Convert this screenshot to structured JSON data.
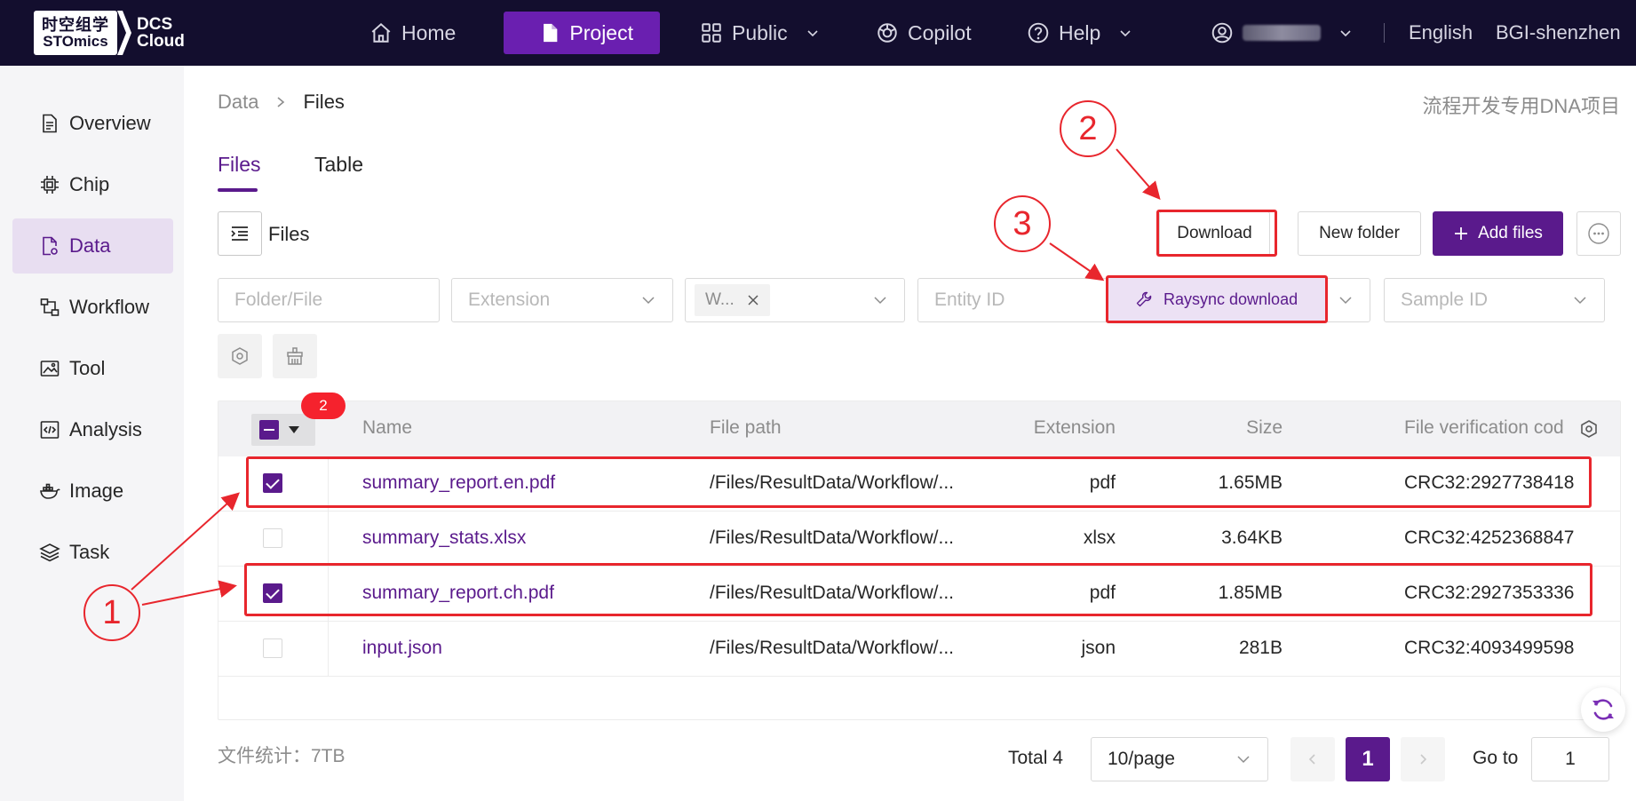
{
  "header": {
    "logo_line1": "时空组学",
    "logo_line2": "STOmics",
    "logo_right1": "DCS",
    "logo_right2": "Cloud",
    "nav": [
      {
        "label": "Home"
      },
      {
        "label": "Project"
      },
      {
        "label": "Public"
      },
      {
        "label": "Copilot"
      },
      {
        "label": "Help"
      }
    ],
    "language": "English",
    "org": "BGI-shenzhen"
  },
  "sidebar": {
    "items": [
      {
        "label": "Overview",
        "icon": "document-icon"
      },
      {
        "label": "Chip",
        "icon": "chip-icon"
      },
      {
        "label": "Data",
        "icon": "data-file-icon"
      },
      {
        "label": "Workflow",
        "icon": "workflow-icon"
      },
      {
        "label": "Tool",
        "icon": "tool-icon"
      },
      {
        "label": "Analysis",
        "icon": "code-icon"
      },
      {
        "label": "Image",
        "icon": "docker-icon"
      },
      {
        "label": "Task",
        "icon": "layers-icon"
      }
    ]
  },
  "breadcrumb": {
    "parent": "Data",
    "current": "Files"
  },
  "project_name": "流程开发专用DNA项目",
  "tabs": [
    {
      "label": "Files"
    },
    {
      "label": "Table"
    }
  ],
  "toolbar": {
    "files_label": "Files",
    "download": "Download",
    "new_folder": "New folder",
    "add_files": "Add files",
    "raysync": "Raysync download"
  },
  "filters": {
    "folder_placeholder": "Folder/File",
    "extension_placeholder": "Extension",
    "tag_value": "W...",
    "entity_placeholder": "Entity ID",
    "sample_placeholder": "Sample ID"
  },
  "table": {
    "selected_count": "2",
    "columns": [
      "Name",
      "File path",
      "Extension",
      "Size",
      "File verification cod"
    ],
    "rows": [
      {
        "name": "summary_report.en.pdf",
        "path": "/Files/ResultData/Workflow/...",
        "ext": "pdf",
        "size": "1.65MB",
        "crc": "CRC32:2927738418",
        "checked": true
      },
      {
        "name": "summary_stats.xlsx",
        "path": "/Files/ResultData/Workflow/...",
        "ext": "xlsx",
        "size": "3.64KB",
        "crc": "CRC32:4252368847",
        "checked": false
      },
      {
        "name": "summary_report.ch.pdf",
        "path": "/Files/ResultData/Workflow/...",
        "ext": "pdf",
        "size": "1.85MB",
        "crc": "CRC32:2927353336",
        "checked": true
      },
      {
        "name": "input.json",
        "path": "/Files/ResultData/Workflow/...",
        "ext": "json",
        "size": "281B",
        "crc": "CRC32:4093499598",
        "checked": false
      }
    ]
  },
  "footer": {
    "stats": "文件统计：7TB",
    "total": "Total 4",
    "page_size": "10/page",
    "current_page": "1",
    "goto_label": "Go to",
    "goto_value": "1"
  },
  "annotations": {
    "c1": "1",
    "c2": "2",
    "c3": "3"
  },
  "colors": {
    "nav_bg": "#130e2e",
    "accent": "#5a1a8c",
    "annotation_red": "#e8262d"
  }
}
